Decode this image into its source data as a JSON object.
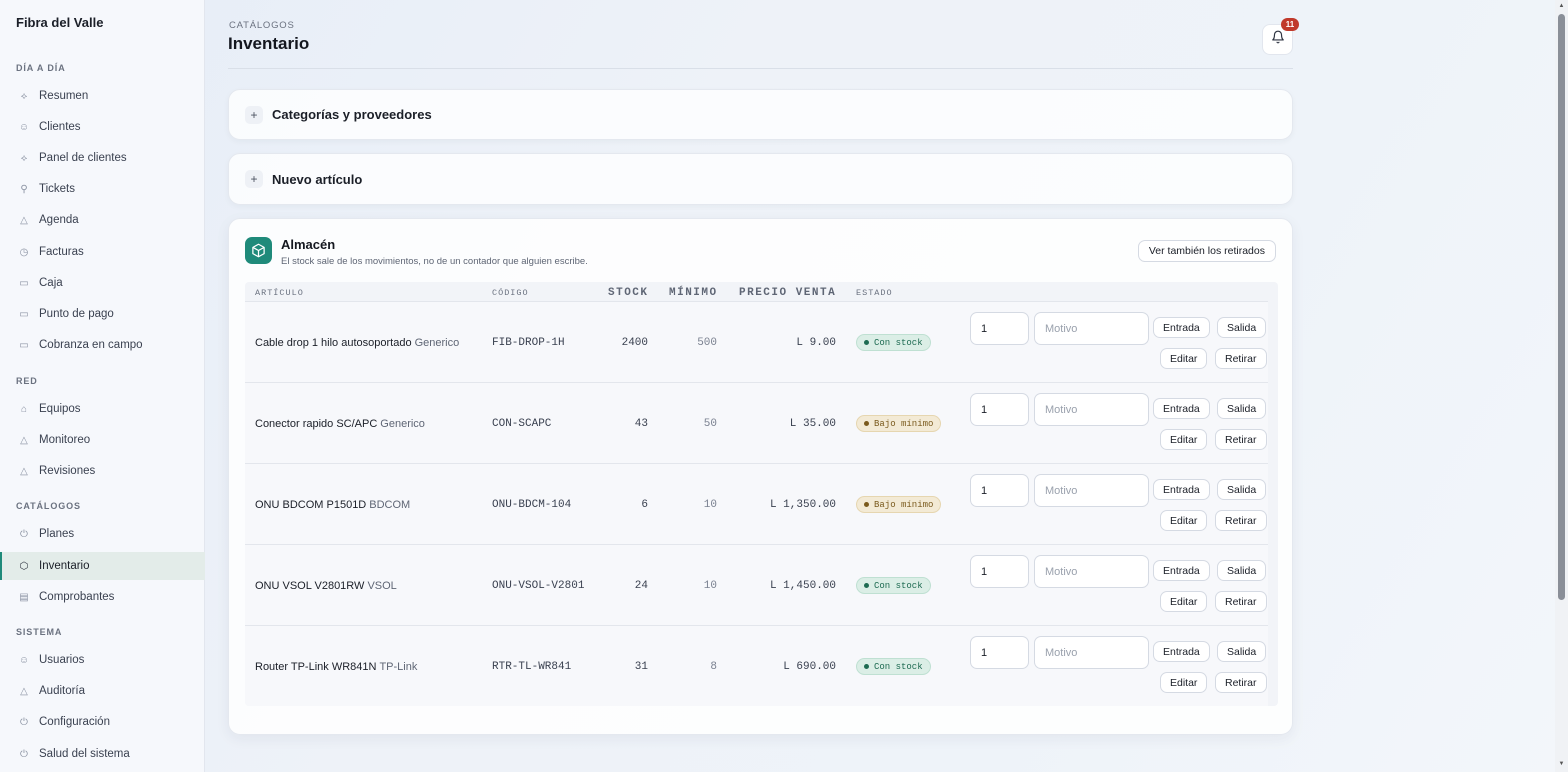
{
  "app": {
    "name": "Fibra del Valle"
  },
  "sidebar": {
    "sections": [
      {
        "title": "DÍA A DÍA",
        "items": [
          {
            "label": "Resumen",
            "icon": "activity-icon"
          },
          {
            "label": "Clientes",
            "icon": "users-icon"
          },
          {
            "label": "Panel de clientes",
            "icon": "activity-icon"
          },
          {
            "label": "Tickets",
            "icon": "wrench-icon"
          },
          {
            "label": "Agenda",
            "icon": "triangle-icon"
          },
          {
            "label": "Facturas",
            "icon": "clock-icon"
          },
          {
            "label": "Caja",
            "icon": "card-icon"
          },
          {
            "label": "Punto de pago",
            "icon": "card-icon"
          },
          {
            "label": "Cobranza en campo",
            "icon": "card-icon"
          }
        ]
      },
      {
        "title": "RED",
        "items": [
          {
            "label": "Equipos",
            "icon": "router-icon"
          },
          {
            "label": "Monitoreo",
            "icon": "triangle-icon"
          },
          {
            "label": "Revisiones",
            "icon": "triangle-icon"
          }
        ]
      },
      {
        "title": "CATÁLOGOS",
        "items": [
          {
            "label": "Planes",
            "icon": "power-icon"
          },
          {
            "label": "Inventario",
            "icon": "box-icon",
            "active": true
          },
          {
            "label": "Comprobantes",
            "icon": "document-icon"
          }
        ]
      },
      {
        "title": "SISTEMA",
        "items": [
          {
            "label": "Usuarios",
            "icon": "users-icon"
          },
          {
            "label": "Auditoría",
            "icon": "triangle-icon"
          },
          {
            "label": "Configuración",
            "icon": "power-icon"
          },
          {
            "label": "Salud del sistema",
            "icon": "power-icon"
          }
        ]
      }
    ]
  },
  "header": {
    "breadcrumb": "CATÁLOGOS",
    "title": "Inventario",
    "notifications_count": "11"
  },
  "panels": {
    "categories": "Categorías y proveedores",
    "new_item": "Nuevo artículo",
    "expand_glyph": "+"
  },
  "warehouse": {
    "title": "Almacén",
    "subtitle": "El stock sale de los movimientos, no de un contador que alguien escribe.",
    "show_retired_label": "Ver también los retirados",
    "columns": {
      "article": "ARTÍCULO",
      "code": "CÓDIGO",
      "stock": "STOCK",
      "minimum": "MÍNIMO",
      "price": "PRECIO VENTA",
      "status": "ESTADO"
    },
    "actions": {
      "motivo_placeholder": "Motivo",
      "entry": "Entrada",
      "exit": "Salida",
      "edit": "Editar",
      "retire": "Retirar"
    },
    "rows": [
      {
        "name": "Cable drop 1 hilo autosoportado",
        "brand": "Generico",
        "code": "FIB-DROP-1H",
        "stock": "2400",
        "minimum": "500",
        "price": "L 9.00",
        "status": "Con stock",
        "status_kind": "ok",
        "qty": "1"
      },
      {
        "name": "Conector rapido SC/APC",
        "brand": "Generico",
        "code": "CON-SCAPC",
        "stock": "43",
        "minimum": "50",
        "price": "L 35.00",
        "status": "Bajo mínimo",
        "status_kind": "low",
        "qty": "1"
      },
      {
        "name": "ONU BDCOM P1501D",
        "brand": "BDCOM",
        "code": "ONU-BDCM-104",
        "stock": "6",
        "minimum": "10",
        "price": "L 1,350.00",
        "status": "Bajo mínimo",
        "status_kind": "low",
        "qty": "1"
      },
      {
        "name": "ONU VSOL V2801RW",
        "brand": "VSOL",
        "code": "ONU-VSOL-V2801",
        "stock": "24",
        "minimum": "10",
        "price": "L 1,450.00",
        "status": "Con stock",
        "status_kind": "ok",
        "qty": "1"
      },
      {
        "name": "Router TP-Link WR841N",
        "brand": "TP-Link",
        "code": "RTR-TL-WR841",
        "stock": "31",
        "minimum": "8",
        "price": "L 690.00",
        "status": "Con stock",
        "status_kind": "ok",
        "qty": "1"
      }
    ]
  },
  "colors": {
    "accent": "#1f8a7a",
    "ok": "#1e6b52",
    "low": "#7a5a1d",
    "badge": "#c0392b"
  }
}
